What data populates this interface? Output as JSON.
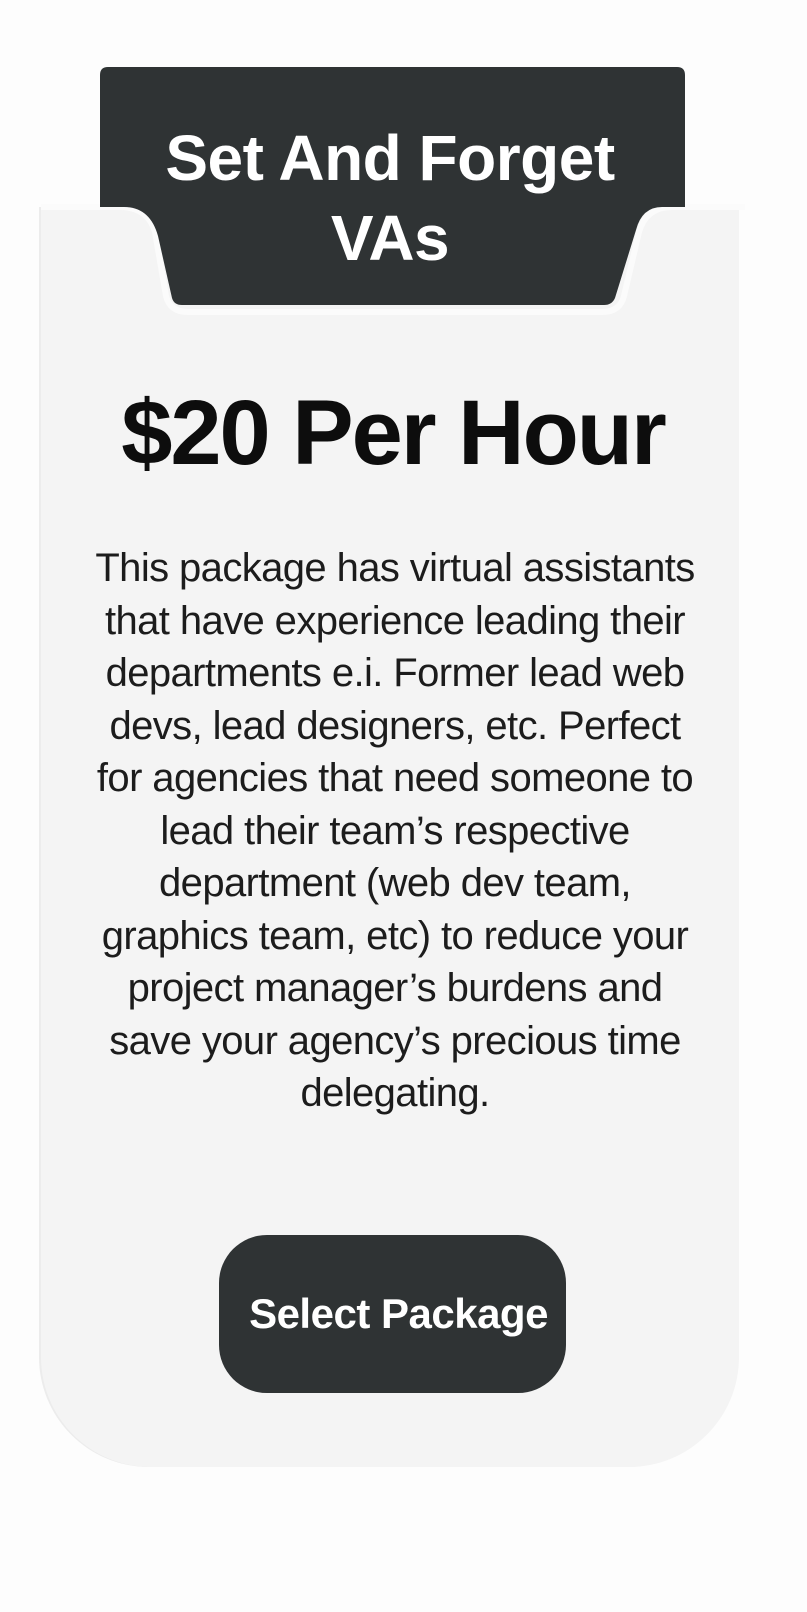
{
  "package": {
    "title": "Set And Forget VAs",
    "price": "$20 Per Hour",
    "description": "This package has virtual assistants that have experience leading their departments e.i. Former lead web devs, lead designers, etc. Perfect for agencies that need someone to lead their team’s respective department (web dev team, graphics team, etc) to reduce your project manager’s burdens and save your agency’s precious time delegating.",
    "button_label": "Select Package"
  },
  "colors": {
    "dark": "#2f3334",
    "card": "#f4f4f4",
    "text": "#0d0d0d"
  }
}
